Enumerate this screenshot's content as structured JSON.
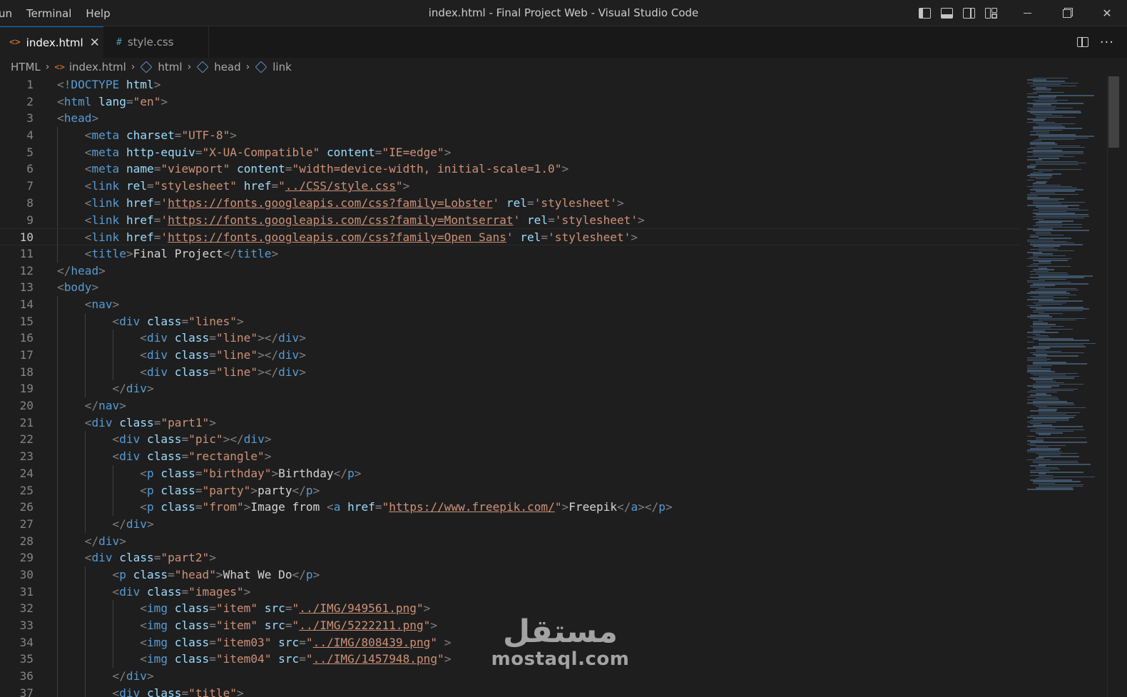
{
  "window": {
    "title": "index.html - Final Project Web - Visual Studio Code"
  },
  "menu": [
    "un",
    "Terminal",
    "Help"
  ],
  "tabs": [
    {
      "label": "index.html",
      "icon": "html-file-icon",
      "active": true
    },
    {
      "label": "style.css",
      "icon": "css-file-icon",
      "active": false
    }
  ],
  "breadcrumb": [
    "HTML",
    "index.html",
    "html",
    "head",
    "link"
  ],
  "editor": {
    "current_line": 10,
    "lines": [
      "<!DOCTYPE html>",
      "<html lang=\"en\">",
      "<head>",
      "    <meta charset=\"UTF-8\">",
      "    <meta http-equiv=\"X-UA-Compatible\" content=\"IE=edge\">",
      "    <meta name=\"viewport\" content=\"width=device-width, initial-scale=1.0\">",
      "    <link rel=\"stylesheet\" href=\"../CSS/style.css\">",
      "    <link href='https://fonts.googleapis.com/css?family=Lobster' rel='stylesheet'>",
      "    <link href='https://fonts.googleapis.com/css?family=Montserrat' rel='stylesheet'>",
      "    <link href='https://fonts.googleapis.com/css?family=Open Sans' rel='stylesheet'>",
      "    <title>Final Project</title>",
      "</head>",
      "<body>",
      "    <nav>",
      "        <div class=\"lines\">",
      "            <div class=\"line\"></div>",
      "            <div class=\"line\"></div>",
      "            <div class=\"line\"></div>",
      "        </div>",
      "    </nav>",
      "    <div class=\"part1\">",
      "        <div class=\"pic\"></div>",
      "        <div class=\"rectangle\">",
      "            <p class=\"birthday\">Birthday</p>",
      "            <p class=\"party\">party</p>",
      "            <p class=\"from\">Image from <a href=\"https://www.freepik.com/\">Freepik</a></p>",
      "        </div>",
      "    </div>",
      "    <div class=\"part2\">",
      "        <p class=\"head\">What We Do</p>",
      "        <div class=\"images\">",
      "            <img class=\"item\" src=\"../IMG/949561.png\">",
      "            <img class=\"item\" src=\"../IMG/5222211.png\">",
      "            <img class=\"item03\" src=\"../IMG/808439.png\" >",
      "            <img class=\"item04\" src=\"../IMG/1457948.png\">",
      "        </div>",
      "        <div class=\"title\">"
    ]
  },
  "watermark": {
    "arabic": "مستقل",
    "latin": "mostaql.com"
  }
}
